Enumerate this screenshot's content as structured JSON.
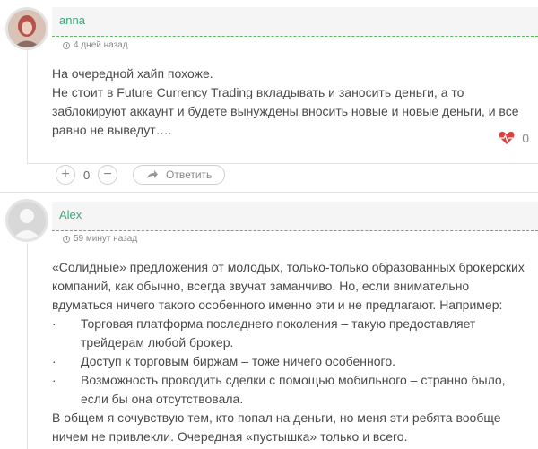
{
  "comments": [
    {
      "author": "anna",
      "time": "4 дней назад",
      "lines": [
        "На очередной хайп похоже.",
        "Не стоит в Future Currency Trading вкладывать и заносить деньги, а то заблокируют аккаунт и будете вынуждены вносить новые и новые деньги, и все равно не выведут…."
      ],
      "likes": "0",
      "votes": "0",
      "reply_label": "Ответить",
      "plus_label": "+",
      "minus_label": "−"
    },
    {
      "author": "Alex",
      "time": "59 минут назад",
      "lines": [
        "«Солидные» предложения от молодых, только-только образованных брокерских компаний, как обычно, всегда звучат заманчиво. Но, если внимательно вдуматься ничего такого особенного именно эти и не предлагают. Например:"
      ],
      "bullets": [
        "Торговая платформа последнего поколения – такую предоставляет трейдерам любой брокер.",
        "Доступ к торговым биржам – тоже ничего особенного.",
        "Возможность проводить сделки с помощью мобильного – странно было, если бы она отсутствовала."
      ],
      "closing": "В общем я сочувствую тем, кто попал на деньги, но меня эти ребята вообще ничем не привлекли. Очередная «пустышка» только и всего.",
      "bullet_mark": "·"
    }
  ],
  "icons": {
    "heart": "heart-pulse-icon",
    "clock": "clock-icon",
    "reply": "reply-arrow-icon",
    "avatar_photo": "user-photo-avatar",
    "avatar_default": "default-user-avatar"
  },
  "colors": {
    "accent_green": "#3ba776",
    "heart_red": "#e0403f"
  }
}
